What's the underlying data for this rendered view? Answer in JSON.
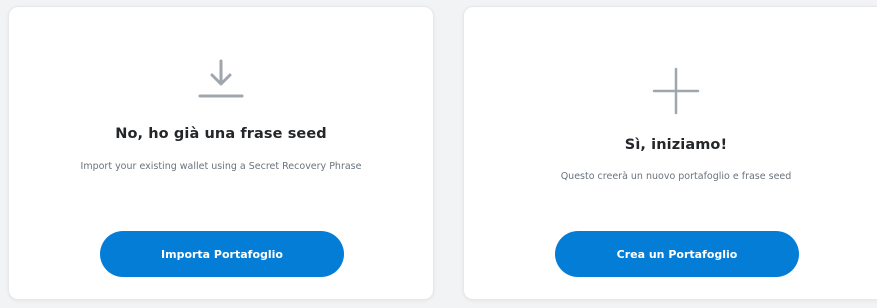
{
  "import_card": {
    "icon": "download-icon",
    "title": "No, ho già una frase seed",
    "description": "Import your existing wallet using a Secret Recovery Phrase",
    "button_label": "Importa Portafoglio"
  },
  "create_card": {
    "icon": "plus-icon",
    "title": "Sì, iniziamo!",
    "description": "Questo creerà un nuovo portafoglio e frase seed",
    "button_label": "Crea un Portafoglio"
  },
  "colors": {
    "background": "#f2f3f4",
    "card": "#ffffff",
    "button": "#037dd6",
    "title": "#24272a",
    "description": "#6a737d",
    "icon": "#9fa6ae"
  }
}
